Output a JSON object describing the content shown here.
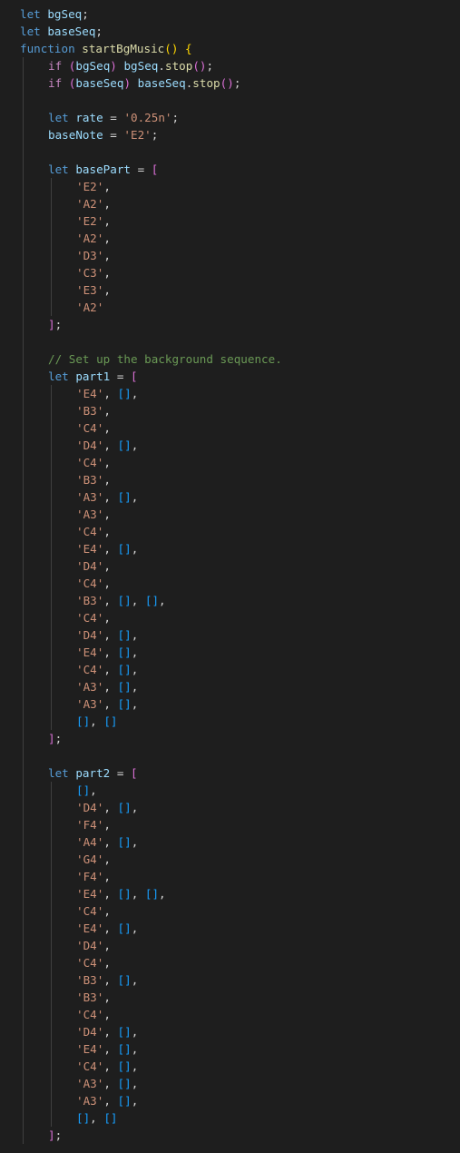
{
  "editor": {
    "colors": {
      "background": "#1e1e1e",
      "keyword": "#569cd6",
      "control_keyword": "#c586c0",
      "function": "#dcdcaa",
      "variable": "#9cdcfe",
      "string": "#ce9178",
      "comment": "#6a9955",
      "text": "#d4d4d4",
      "bracket_level_1": "#ffd700",
      "bracket_level_2": "#da70d6",
      "bracket_level_3": "#179fff"
    },
    "lines": [
      {
        "indent": 0,
        "tokens": [
          [
            "kw",
            "let"
          ],
          [
            "p",
            " "
          ],
          [
            "var",
            "bgSeq"
          ],
          [
            "p",
            ";"
          ]
        ]
      },
      {
        "indent": 0,
        "tokens": [
          [
            "kw",
            "let"
          ],
          [
            "p",
            " "
          ],
          [
            "var",
            "baseSeq"
          ],
          [
            "p",
            ";"
          ]
        ]
      },
      {
        "indent": 0,
        "tokens": [
          [
            "kw",
            "function"
          ],
          [
            "p",
            " "
          ],
          [
            "fn",
            "startBgMusic"
          ],
          [
            "b1",
            "()"
          ],
          [
            "p",
            " "
          ],
          [
            "b1",
            "{"
          ]
        ]
      },
      {
        "indent": 1,
        "tokens": [
          [
            "ctl",
            "if"
          ],
          [
            "p",
            " "
          ],
          [
            "b2",
            "("
          ],
          [
            "var",
            "bgSeq"
          ],
          [
            "b2",
            ")"
          ],
          [
            "p",
            " "
          ],
          [
            "var",
            "bgSeq"
          ],
          [
            "p",
            "."
          ],
          [
            "fn",
            "stop"
          ],
          [
            "b2",
            "()"
          ],
          [
            "p",
            ";"
          ]
        ]
      },
      {
        "indent": 1,
        "tokens": [
          [
            "ctl",
            "if"
          ],
          [
            "p",
            " "
          ],
          [
            "b2",
            "("
          ],
          [
            "var",
            "baseSeq"
          ],
          [
            "b2",
            ")"
          ],
          [
            "p",
            " "
          ],
          [
            "var",
            "baseSeq"
          ],
          [
            "p",
            "."
          ],
          [
            "fn",
            "stop"
          ],
          [
            "b2",
            "()"
          ],
          [
            "p",
            ";"
          ]
        ]
      },
      {
        "indent": 1,
        "tokens": []
      },
      {
        "indent": 1,
        "tokens": [
          [
            "kw",
            "let"
          ],
          [
            "p",
            " "
          ],
          [
            "var",
            "rate"
          ],
          [
            "p",
            " = "
          ],
          [
            "str",
            "'0.25n'"
          ],
          [
            "p",
            ";"
          ]
        ]
      },
      {
        "indent": 1,
        "tokens": [
          [
            "var",
            "baseNote"
          ],
          [
            "p",
            " = "
          ],
          [
            "str",
            "'E2'"
          ],
          [
            "p",
            ";"
          ]
        ]
      },
      {
        "indent": 1,
        "tokens": []
      },
      {
        "indent": 1,
        "tokens": [
          [
            "kw",
            "let"
          ],
          [
            "p",
            " "
          ],
          [
            "var",
            "basePart"
          ],
          [
            "p",
            " = "
          ],
          [
            "b2",
            "["
          ]
        ]
      },
      {
        "indent": 2,
        "tokens": [
          [
            "str",
            "'E2'"
          ],
          [
            "p",
            ","
          ]
        ]
      },
      {
        "indent": 2,
        "tokens": [
          [
            "str",
            "'A2'"
          ],
          [
            "p",
            ","
          ]
        ]
      },
      {
        "indent": 2,
        "tokens": [
          [
            "str",
            "'E2'"
          ],
          [
            "p",
            ","
          ]
        ]
      },
      {
        "indent": 2,
        "tokens": [
          [
            "str",
            "'A2'"
          ],
          [
            "p",
            ","
          ]
        ]
      },
      {
        "indent": 2,
        "tokens": [
          [
            "str",
            "'D3'"
          ],
          [
            "p",
            ","
          ]
        ]
      },
      {
        "indent": 2,
        "tokens": [
          [
            "str",
            "'C3'"
          ],
          [
            "p",
            ","
          ]
        ]
      },
      {
        "indent": 2,
        "tokens": [
          [
            "str",
            "'E3'"
          ],
          [
            "p",
            ","
          ]
        ]
      },
      {
        "indent": 2,
        "tokens": [
          [
            "str",
            "'A2'"
          ]
        ]
      },
      {
        "indent": 1,
        "tokens": [
          [
            "b2",
            "]"
          ],
          [
            "p",
            ";"
          ]
        ]
      },
      {
        "indent": 1,
        "tokens": []
      },
      {
        "indent": 1,
        "tokens": [
          [
            "cm",
            "// Set up the background sequence."
          ]
        ]
      },
      {
        "indent": 1,
        "tokens": [
          [
            "kw",
            "let"
          ],
          [
            "p",
            " "
          ],
          [
            "var",
            "part1"
          ],
          [
            "p",
            " = "
          ],
          [
            "b2",
            "["
          ]
        ]
      },
      {
        "indent": 2,
        "tokens": [
          [
            "str",
            "'E4'"
          ],
          [
            "p",
            ", "
          ],
          [
            "b3",
            "[]"
          ],
          [
            "p",
            ","
          ]
        ]
      },
      {
        "indent": 2,
        "tokens": [
          [
            "str",
            "'B3'"
          ],
          [
            "p",
            ","
          ]
        ]
      },
      {
        "indent": 2,
        "tokens": [
          [
            "str",
            "'C4'"
          ],
          [
            "p",
            ","
          ]
        ]
      },
      {
        "indent": 2,
        "tokens": [
          [
            "str",
            "'D4'"
          ],
          [
            "p",
            ", "
          ],
          [
            "b3",
            "[]"
          ],
          [
            "p",
            ","
          ]
        ]
      },
      {
        "indent": 2,
        "tokens": [
          [
            "str",
            "'C4'"
          ],
          [
            "p",
            ","
          ]
        ]
      },
      {
        "indent": 2,
        "tokens": [
          [
            "str",
            "'B3'"
          ],
          [
            "p",
            ","
          ]
        ]
      },
      {
        "indent": 2,
        "tokens": [
          [
            "str",
            "'A3'"
          ],
          [
            "p",
            ", "
          ],
          [
            "b3",
            "[]"
          ],
          [
            "p",
            ","
          ]
        ]
      },
      {
        "indent": 2,
        "tokens": [
          [
            "str",
            "'A3'"
          ],
          [
            "p",
            ","
          ]
        ]
      },
      {
        "indent": 2,
        "tokens": [
          [
            "str",
            "'C4'"
          ],
          [
            "p",
            ","
          ]
        ]
      },
      {
        "indent": 2,
        "tokens": [
          [
            "str",
            "'E4'"
          ],
          [
            "p",
            ", "
          ],
          [
            "b3",
            "[]"
          ],
          [
            "p",
            ","
          ]
        ]
      },
      {
        "indent": 2,
        "tokens": [
          [
            "str",
            "'D4'"
          ],
          [
            "p",
            ","
          ]
        ]
      },
      {
        "indent": 2,
        "tokens": [
          [
            "str",
            "'C4'"
          ],
          [
            "p",
            ","
          ]
        ]
      },
      {
        "indent": 2,
        "tokens": [
          [
            "str",
            "'B3'"
          ],
          [
            "p",
            ", "
          ],
          [
            "b3",
            "[]"
          ],
          [
            "p",
            ", "
          ],
          [
            "b3",
            "[]"
          ],
          [
            "p",
            ","
          ]
        ]
      },
      {
        "indent": 2,
        "tokens": [
          [
            "str",
            "'C4'"
          ],
          [
            "p",
            ","
          ]
        ]
      },
      {
        "indent": 2,
        "tokens": [
          [
            "str",
            "'D4'"
          ],
          [
            "p",
            ", "
          ],
          [
            "b3",
            "[]"
          ],
          [
            "p",
            ","
          ]
        ]
      },
      {
        "indent": 2,
        "tokens": [
          [
            "str",
            "'E4'"
          ],
          [
            "p",
            ", "
          ],
          [
            "b3",
            "[]"
          ],
          [
            "p",
            ","
          ]
        ]
      },
      {
        "indent": 2,
        "tokens": [
          [
            "str",
            "'C4'"
          ],
          [
            "p",
            ", "
          ],
          [
            "b3",
            "[]"
          ],
          [
            "p",
            ","
          ]
        ]
      },
      {
        "indent": 2,
        "tokens": [
          [
            "str",
            "'A3'"
          ],
          [
            "p",
            ", "
          ],
          [
            "b3",
            "[]"
          ],
          [
            "p",
            ","
          ]
        ]
      },
      {
        "indent": 2,
        "tokens": [
          [
            "str",
            "'A3'"
          ],
          [
            "p",
            ", "
          ],
          [
            "b3",
            "[]"
          ],
          [
            "p",
            ","
          ]
        ]
      },
      {
        "indent": 2,
        "tokens": [
          [
            "b3",
            "[]"
          ],
          [
            "p",
            ", "
          ],
          [
            "b3",
            "[]"
          ]
        ]
      },
      {
        "indent": 1,
        "tokens": [
          [
            "b2",
            "]"
          ],
          [
            "p",
            ";"
          ]
        ]
      },
      {
        "indent": 1,
        "tokens": []
      },
      {
        "indent": 1,
        "tokens": [
          [
            "kw",
            "let"
          ],
          [
            "p",
            " "
          ],
          [
            "var",
            "part2"
          ],
          [
            "p",
            " = "
          ],
          [
            "b2",
            "["
          ]
        ]
      },
      {
        "indent": 2,
        "tokens": [
          [
            "b3",
            "[]"
          ],
          [
            "p",
            ","
          ]
        ]
      },
      {
        "indent": 2,
        "tokens": [
          [
            "str",
            "'D4'"
          ],
          [
            "p",
            ", "
          ],
          [
            "b3",
            "[]"
          ],
          [
            "p",
            ","
          ]
        ]
      },
      {
        "indent": 2,
        "tokens": [
          [
            "str",
            "'F4'"
          ],
          [
            "p",
            ","
          ]
        ]
      },
      {
        "indent": 2,
        "tokens": [
          [
            "str",
            "'A4'"
          ],
          [
            "p",
            ", "
          ],
          [
            "b3",
            "[]"
          ],
          [
            "p",
            ","
          ]
        ]
      },
      {
        "indent": 2,
        "tokens": [
          [
            "str",
            "'G4'"
          ],
          [
            "p",
            ","
          ]
        ]
      },
      {
        "indent": 2,
        "tokens": [
          [
            "str",
            "'F4'"
          ],
          [
            "p",
            ","
          ]
        ]
      },
      {
        "indent": 2,
        "tokens": [
          [
            "str",
            "'E4'"
          ],
          [
            "p",
            ", "
          ],
          [
            "b3",
            "[]"
          ],
          [
            "p",
            ", "
          ],
          [
            "b3",
            "[]"
          ],
          [
            "p",
            ","
          ]
        ]
      },
      {
        "indent": 2,
        "tokens": [
          [
            "str",
            "'C4'"
          ],
          [
            "p",
            ","
          ]
        ]
      },
      {
        "indent": 2,
        "tokens": [
          [
            "str",
            "'E4'"
          ],
          [
            "p",
            ", "
          ],
          [
            "b3",
            "[]"
          ],
          [
            "p",
            ","
          ]
        ]
      },
      {
        "indent": 2,
        "tokens": [
          [
            "str",
            "'D4'"
          ],
          [
            "p",
            ","
          ]
        ]
      },
      {
        "indent": 2,
        "tokens": [
          [
            "str",
            "'C4'"
          ],
          [
            "p",
            ","
          ]
        ]
      },
      {
        "indent": 2,
        "tokens": [
          [
            "str",
            "'B3'"
          ],
          [
            "p",
            ", "
          ],
          [
            "b3",
            "[]"
          ],
          [
            "p",
            ","
          ]
        ]
      },
      {
        "indent": 2,
        "tokens": [
          [
            "str",
            "'B3'"
          ],
          [
            "p",
            ","
          ]
        ]
      },
      {
        "indent": 2,
        "tokens": [
          [
            "str",
            "'C4'"
          ],
          [
            "p",
            ","
          ]
        ]
      },
      {
        "indent": 2,
        "tokens": [
          [
            "str",
            "'D4'"
          ],
          [
            "p",
            ", "
          ],
          [
            "b3",
            "[]"
          ],
          [
            "p",
            ","
          ]
        ]
      },
      {
        "indent": 2,
        "tokens": [
          [
            "str",
            "'E4'"
          ],
          [
            "p",
            ", "
          ],
          [
            "b3",
            "[]"
          ],
          [
            "p",
            ","
          ]
        ]
      },
      {
        "indent": 2,
        "tokens": [
          [
            "str",
            "'C4'"
          ],
          [
            "p",
            ", "
          ],
          [
            "b3",
            "[]"
          ],
          [
            "p",
            ","
          ]
        ]
      },
      {
        "indent": 2,
        "tokens": [
          [
            "str",
            "'A3'"
          ],
          [
            "p",
            ", "
          ],
          [
            "b3",
            "[]"
          ],
          [
            "p",
            ","
          ]
        ]
      },
      {
        "indent": 2,
        "tokens": [
          [
            "str",
            "'A3'"
          ],
          [
            "p",
            ", "
          ],
          [
            "b3",
            "[]"
          ],
          [
            "p",
            ","
          ]
        ]
      },
      {
        "indent": 2,
        "tokens": [
          [
            "b3",
            "[]"
          ],
          [
            "p",
            ", "
          ],
          [
            "b3",
            "[]"
          ]
        ]
      },
      {
        "indent": 1,
        "tokens": [
          [
            "b2",
            "]"
          ],
          [
            "p",
            ";"
          ]
        ]
      }
    ]
  }
}
